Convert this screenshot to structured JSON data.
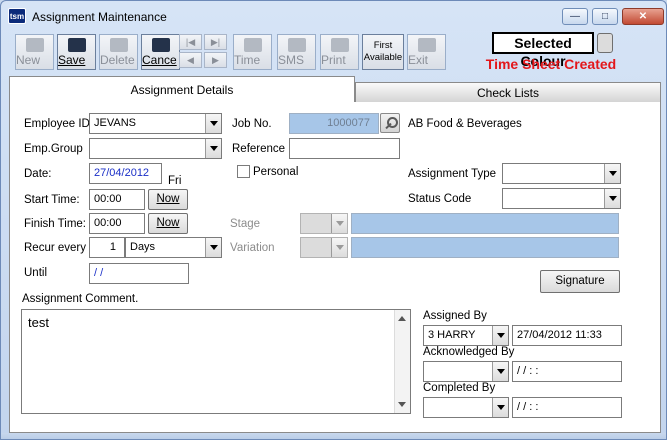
{
  "window": {
    "title": "Assignment Maintenance",
    "app_icon": "tsm"
  },
  "toolbar": {
    "new": "New",
    "save": "Save",
    "delete": "Delete",
    "cancel": "Cance",
    "time": "Time",
    "sms": "SMS",
    "print": "Print",
    "first_available_top": "First",
    "first_available_bottom": "Available",
    "exit": "Exit"
  },
  "status": {
    "selected_colour": "Selected Colour",
    "time_sheet": "Time Sheet Created",
    "time_sheet_color": "#e3171b"
  },
  "tabs": {
    "details": "Assignment Details",
    "checklists": "Check Lists"
  },
  "form": {
    "employee_id_label": "Employee ID:",
    "employee_id": "JEVANS",
    "emp_group_label": "Emp.Group",
    "emp_group": "",
    "date_label": "Date:",
    "date": "27/04/2012",
    "day": "Fri",
    "start_time_label": "Start Time:",
    "start_time": "00:00",
    "finish_time_label": "Finish Time:",
    "finish_time": "00:00",
    "now_label": "Now",
    "recur_label": "Recur every",
    "recur_count": "1",
    "recur_unit": "Days",
    "until_label": "Until",
    "until": " / /",
    "job_no_label": "Job No.",
    "job_no": "1000077",
    "customer": "AB Food & Beverages",
    "reference_label": "Reference",
    "reference": "",
    "personal_label": "Personal",
    "assignment_type_label": "Assignment Type",
    "assignment_type": "",
    "status_code_label": "Status Code",
    "status_code": "",
    "stage_label": "Stage",
    "variation_label": "Variation",
    "signature_label": "Signature",
    "comment_label": "Assignment Comment.",
    "comment": "test",
    "assigned_by_label": "Assigned By",
    "assigned_by": "3 HARRY",
    "assigned_at": "27/04/2012 11:33",
    "acknowledged_by_label": "Acknowledged By",
    "acknowledged_by": "",
    "acknowledged_at": " / /     :  :",
    "completed_by_label": "Completed By",
    "completed_by": "",
    "completed_at": " / /     :  :"
  }
}
